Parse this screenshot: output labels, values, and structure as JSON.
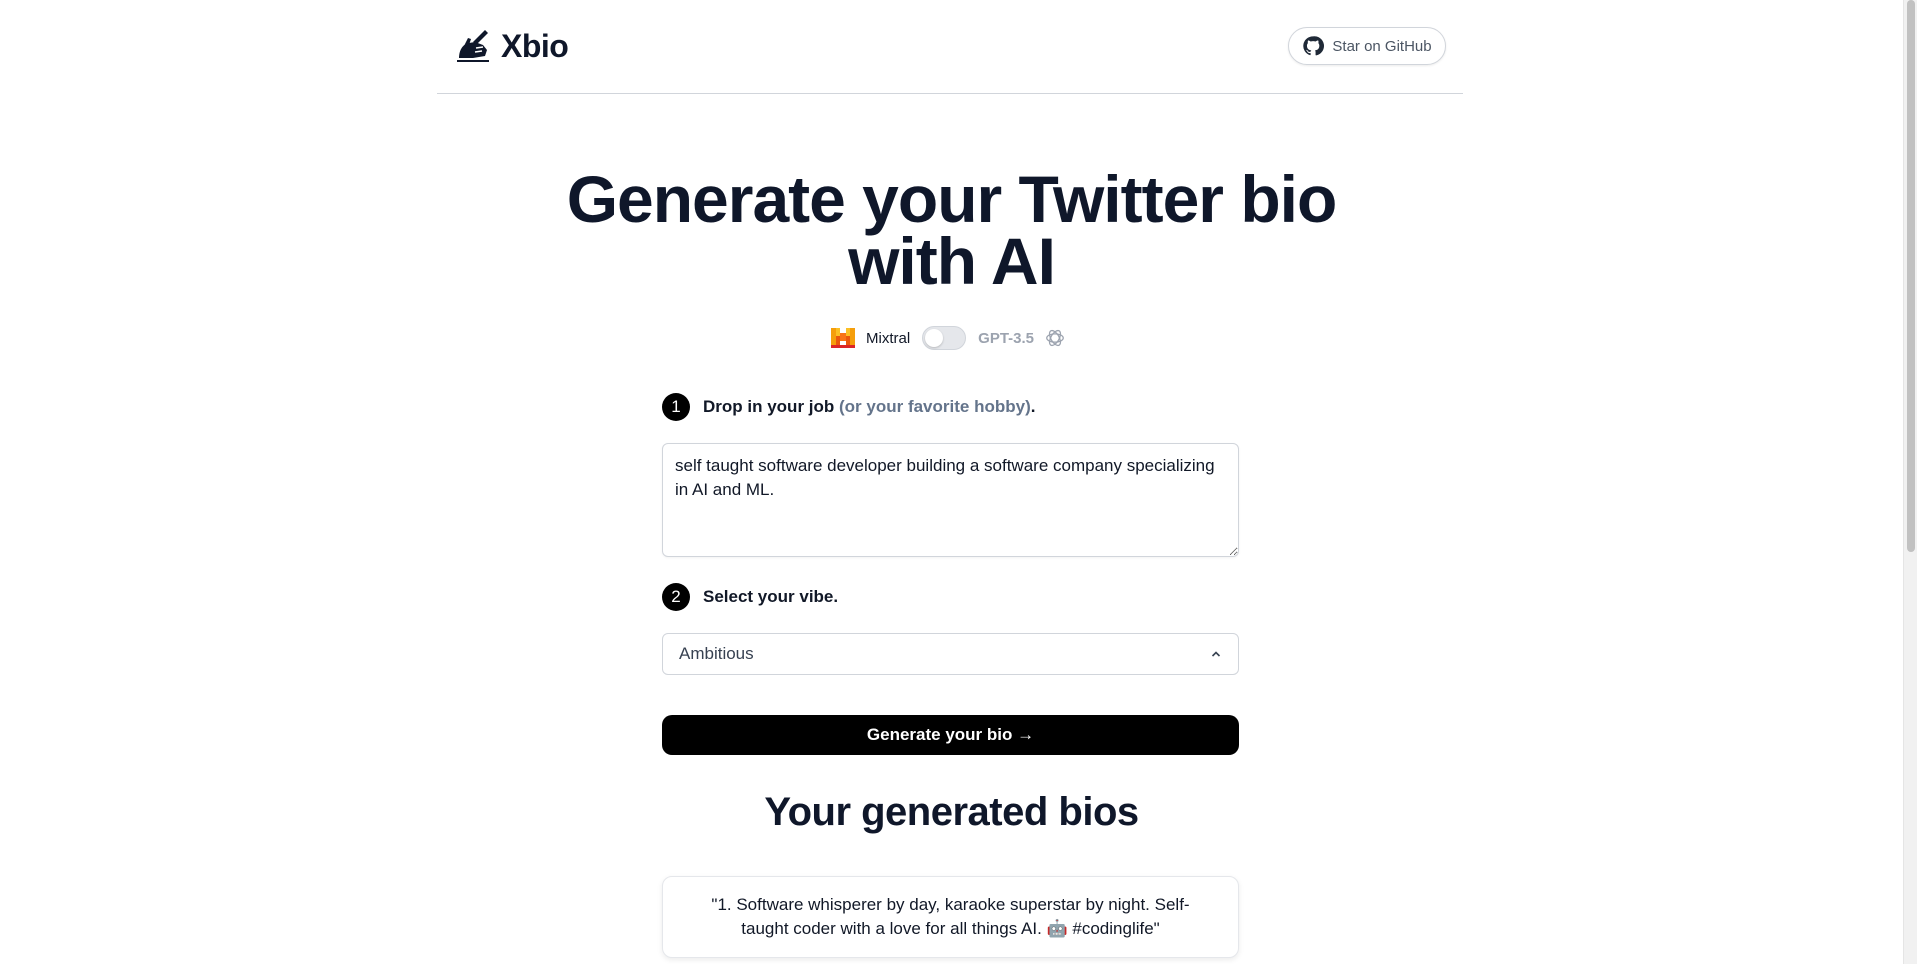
{
  "header": {
    "app_name": "Xbio",
    "github_label": "Star on GitHub"
  },
  "hero": {
    "title_line1": "Generate your Twitter bio",
    "title_line2": "with AI"
  },
  "model_toggle": {
    "left_label": "Mixtral",
    "right_label": "GPT-3.5",
    "selected": "Mixtral"
  },
  "step1": {
    "number": "1",
    "label": "Drop in your job ",
    "hint": "(or your favorite hobby)",
    "suffix": "."
  },
  "job_input": {
    "value": "self taught software developer building a software company specializing in AI and ML."
  },
  "step2": {
    "number": "2",
    "label": "Select your vibe."
  },
  "vibe_select": {
    "value": "Ambitious"
  },
  "generate_button": {
    "label": "Generate your bio →"
  },
  "results": {
    "title": "Your generated bios",
    "bios": [
      "\"1. Software whisperer by day, karaoke superstar by night. Self-taught coder with a love for all things AI. 🤖 #codinglife\""
    ]
  },
  "colors": {
    "primary": "#000000",
    "heading": "#0f172a",
    "muted": "#64748b",
    "border": "#d1d5db"
  }
}
